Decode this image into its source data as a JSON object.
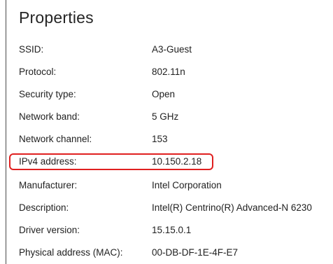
{
  "panel": {
    "title": "Properties"
  },
  "properties": [
    {
      "label": "SSID:",
      "value": "A3-Guest"
    },
    {
      "label": "Protocol:",
      "value": "802.11n"
    },
    {
      "label": "Security type:",
      "value": "Open"
    },
    {
      "label": "Network band:",
      "value": "5 GHz"
    },
    {
      "label": "Network channel:",
      "value": "153"
    },
    {
      "label": "IPv4 address:",
      "value": "10.150.2.18"
    },
    {
      "label": "Manufacturer:",
      "value": "Intel Corporation"
    },
    {
      "label": "Description:",
      "value": "Intel(R) Centrino(R) Advanced-N 6230"
    },
    {
      "label": "Driver version:",
      "value": "15.15.0.1"
    },
    {
      "label": "Physical address (MAC):",
      "value": "00-DB-DF-1E-4F-E7"
    }
  ],
  "colors": {
    "highlight": "#e02020",
    "text": "#1f1f1f"
  }
}
